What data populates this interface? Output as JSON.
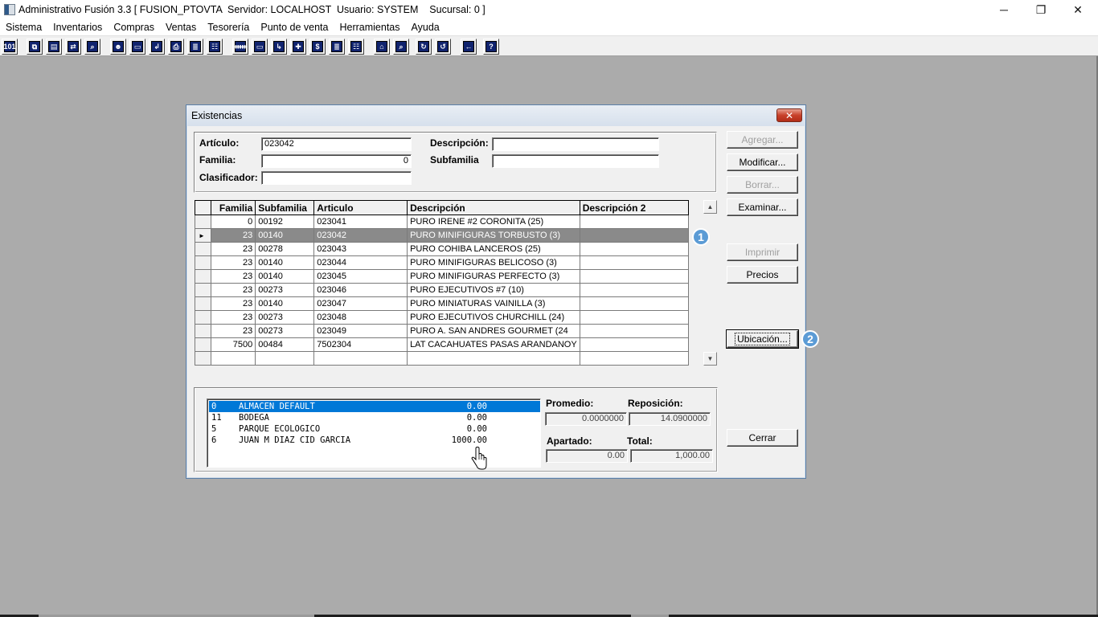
{
  "window": {
    "title": "Administrativo Fusión 3.3 [ FUSION_PTOVTA  Servidor: LOCALHOST  Usuario: SYSTEM    Sucursal: 0 ]",
    "minimize": "─",
    "restore": "❐",
    "close": "✕"
  },
  "menu": [
    "Sistema",
    "Inventarios",
    "Compras",
    "Ventas",
    "Tesorería",
    "Punto de venta",
    "Herramientas",
    "Ayuda"
  ],
  "toolbar": {
    "icons": [
      "calculator-icon",
      "copy-icon",
      "paste-icon",
      "transfer-icon",
      "search-icon",
      "user-icon",
      "folder-icon",
      "import-icon",
      "print-icon",
      "document-icon",
      "list-icon",
      "people-icon",
      "open-icon",
      "export-icon",
      "add-icon",
      "money-icon",
      "report-icon",
      "table-icon",
      "home-icon",
      "zoom-icon",
      "refresh-icon",
      "undo-icon",
      "back-icon",
      "help-icon"
    ],
    "glyphs": [
      "101",
      "⧉",
      "▤",
      "⇄",
      "⌕",
      "☻",
      "▭",
      "↲",
      "⎙",
      "≣",
      "☷",
      "ᚔ",
      "▭",
      "↳",
      "✚",
      "$",
      "≣",
      "☷",
      "⌂",
      "⌕",
      "↻",
      "↺",
      "←",
      "?"
    ]
  },
  "dialog": {
    "title": "Existencias",
    "close_glyph": "✕",
    "filters": {
      "articulo_label": "Artículo:",
      "articulo_value": "023042",
      "familia_label": "Familia:",
      "familia_value": "0",
      "clasificador_label": "Clasificador:",
      "clasificador_value": "",
      "descripcion_label": "Descripción:",
      "descripcion_value": "",
      "subfamilia_label": "Subfamilia",
      "subfamilia_value": ""
    },
    "grid": {
      "columns": [
        "Familia",
        "Subfamilia",
        "Articulo",
        "Descripción",
        "Descripción 2"
      ],
      "selected_marker": "►",
      "rows": [
        {
          "familia": "0",
          "subfamilia": "00192",
          "articulo": "023041",
          "descripcion": "PURO IRENE #2 CORONITA (25)",
          "descripcion2": ""
        },
        {
          "familia": "23",
          "subfamilia": "00140",
          "articulo": "023042",
          "descripcion": "PURO MINIFIGURAS TORBUSTO (3)",
          "descripcion2": ""
        },
        {
          "familia": "23",
          "subfamilia": "00278",
          "articulo": "023043",
          "descripcion": "PURO COHIBA LANCEROS (25)",
          "descripcion2": ""
        },
        {
          "familia": "23",
          "subfamilia": "00140",
          "articulo": "023044",
          "descripcion": "PURO MINIFIGURAS BELICOSO (3)",
          "descripcion2": ""
        },
        {
          "familia": "23",
          "subfamilia": "00140",
          "articulo": "023045",
          "descripcion": "PURO MINIFIGURAS PERFECTO (3)",
          "descripcion2": ""
        },
        {
          "familia": "23",
          "subfamilia": "00273",
          "articulo": "023046",
          "descripcion": "PURO EJECUTIVOS #7 (10)",
          "descripcion2": ""
        },
        {
          "familia": "23",
          "subfamilia": "00140",
          "articulo": "023047",
          "descripcion": "PURO MINIATURAS VAINILLA (3)",
          "descripcion2": ""
        },
        {
          "familia": "23",
          "subfamilia": "00273",
          "articulo": "023048",
          "descripcion": "PURO EJECUTIVOS CHURCHILL (24)",
          "descripcion2": ""
        },
        {
          "familia": "23",
          "subfamilia": "00273",
          "articulo": "023049",
          "descripcion": "PURO A. SAN ANDRES GOURMET (24",
          "descripcion2": ""
        },
        {
          "familia": "7500",
          "subfamilia": "00484",
          "articulo": "7502304",
          "descripcion": "LAT CACAHUATES PASAS ARANDANOY",
          "descripcion2": ""
        },
        {
          "familia": "",
          "subfamilia": "",
          "articulo": "",
          "descripcion": "",
          "descripcion2": ""
        }
      ]
    },
    "buttons": {
      "agregar": "Agregar...",
      "modificar": "Modificar...",
      "borrar": "Borrar...",
      "examinar": "Examinar...",
      "imprimir": "Imprimir",
      "precios": "Precios",
      "ubicacion": "Ubicación...",
      "cerrar": "Cerrar"
    },
    "badges": {
      "one": "1",
      "two": "2"
    },
    "warehouses": [
      {
        "code": "0",
        "name": "ALMACEN DEFAULT",
        "qty": "0.00"
      },
      {
        "code": "11",
        "name": "BODEGA",
        "qty": "0.00"
      },
      {
        "code": "5",
        "name": "PARQUE ECOLOGICO",
        "qty": "0.00"
      },
      {
        "code": "6",
        "name": "JUAN M DIAZ CID GARCIA",
        "qty": "1000.00"
      }
    ],
    "totals": {
      "promedio_label": "Promedio:",
      "promedio_value": "0.0000000",
      "reposicion_label": "Reposición:",
      "reposicion_value": "14.0900000",
      "apartado_label": "Apartado:",
      "apartado_value": "0.00",
      "total_label": "Total:",
      "total_value": "1,000.00"
    }
  }
}
